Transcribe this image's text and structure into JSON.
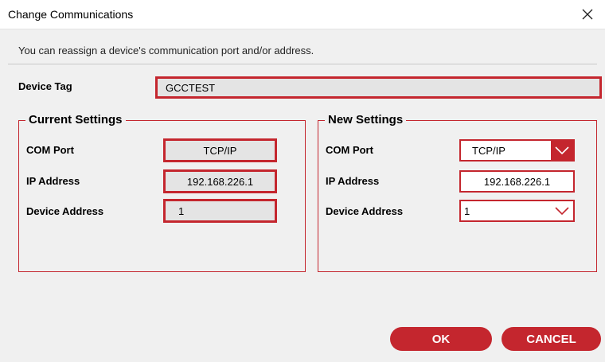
{
  "window": {
    "title": "Change Communications"
  },
  "intro": "You can reassign a device's communication port and/or address.",
  "device_tag": {
    "label": "Device Tag",
    "value": "GCCTEST"
  },
  "current": {
    "title": "Current Settings",
    "com_port_label": "COM Port",
    "com_port_value": "TCP/IP",
    "ip_label": "IP Address",
    "ip_value": "192.168.226.1",
    "addr_label": "Device Address",
    "addr_value": "1"
  },
  "new": {
    "title": "New Settings",
    "com_port_label": "COM Port",
    "com_port_value": "TCP/IP",
    "ip_label": "IP Address",
    "ip_value": "192.168.226.1",
    "addr_label": "Device Address",
    "addr_value": "1"
  },
  "buttons": {
    "ok": "OK",
    "cancel": "CANCEL"
  },
  "colors": {
    "accent": "#c4262e",
    "readonly_bg": "#e4e4e4",
    "window_bg": "#f0f0f0"
  },
  "icons": {
    "close": "close-icon",
    "dropdown": "chevron-down-icon"
  }
}
